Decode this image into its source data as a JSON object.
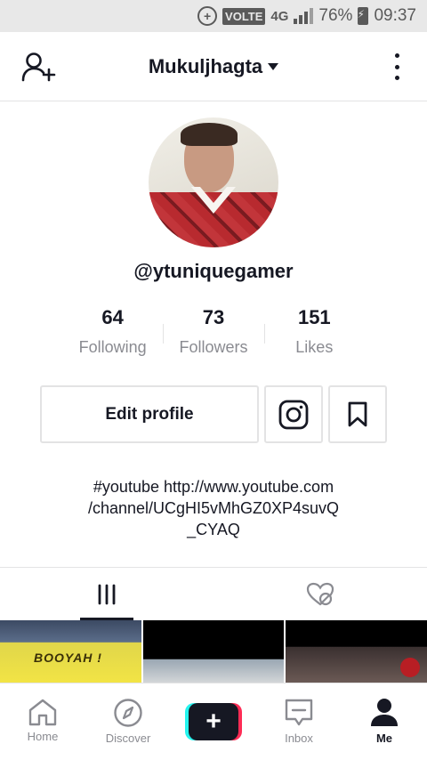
{
  "status_bar": {
    "volte": "VOLTE",
    "network": "4G",
    "battery": "76%",
    "time": "09:37"
  },
  "header": {
    "username": "Mukuljhagta"
  },
  "profile": {
    "handle": "@ytuniquegamer",
    "stats": [
      {
        "value": "64",
        "label": "Following"
      },
      {
        "value": "73",
        "label": "Followers"
      },
      {
        "value": "151",
        "label": "Likes"
      }
    ],
    "edit_label": "Edit profile",
    "bio_lines": [
      "#youtube http://www.youtube.com",
      "/channel/UCgHI5vMhGZ0XP4suvQ",
      "_CYAQ"
    ]
  },
  "grid": {
    "thumb_1_text": "BOOYAH !"
  },
  "bottom_nav": {
    "home": "Home",
    "discover": "Discover",
    "create": "+",
    "inbox": "Inbox",
    "me": "Me"
  },
  "colors": {
    "accent_red": "#fe2c55",
    "accent_cyan": "#25f4ee",
    "text_dark": "#161823",
    "text_gray": "#8a8b91"
  }
}
